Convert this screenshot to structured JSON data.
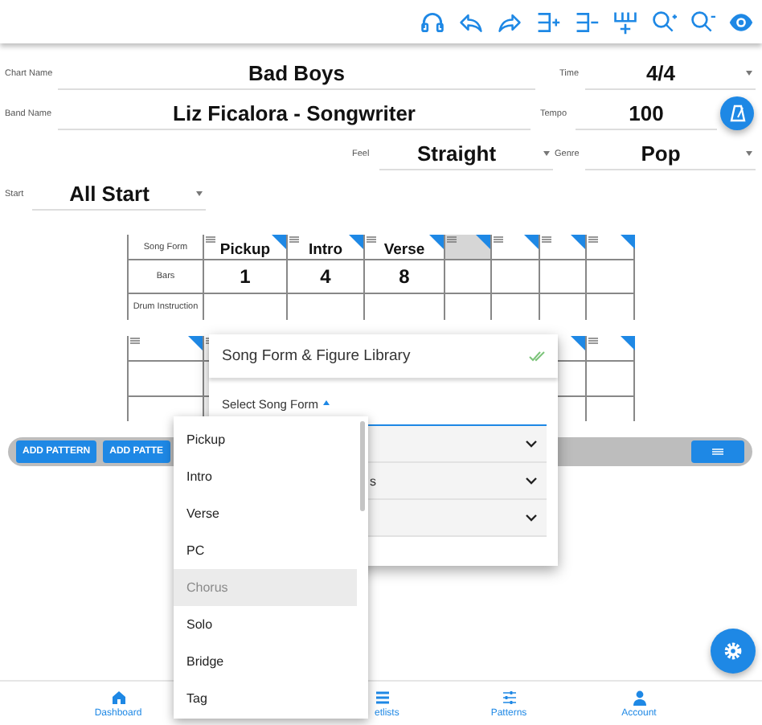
{
  "header_rows": [
    [
      {
        "label": "Chart Name",
        "value": "Bad Boys",
        "kind": "text"
      },
      {
        "label": "Time",
        "value": "4/4",
        "kind": "select"
      }
    ],
    [
      {
        "label": "Band Name",
        "value": "Liz Ficalora - Songwriter",
        "kind": "text"
      },
      {
        "label": "Tempo",
        "value": "100",
        "kind": "text"
      }
    ],
    [
      {
        "label": "Feel",
        "value": "Straight",
        "kind": "select"
      },
      {
        "label": "Genre",
        "value": "Pop",
        "kind": "select"
      }
    ],
    [
      {
        "label": "Start",
        "value": "All Start",
        "kind": "select"
      }
    ]
  ],
  "song_form_table": {
    "row_labels": [
      "Song Form",
      "Bars",
      "Drum Instruction"
    ],
    "columns": [
      {
        "section": "Pickup",
        "bars": "1",
        "selected": false
      },
      {
        "section": "Intro",
        "bars": "4",
        "selected": false
      },
      {
        "section": "Verse",
        "bars": "8",
        "selected": false
      },
      {
        "selected": true
      },
      {
        "selected": false
      },
      {
        "selected": false
      },
      {
        "selected": false
      }
    ]
  },
  "pattern_bar": {
    "buttons": [
      "ADD PATTERN",
      "ADD PATTE"
    ]
  },
  "library_popup": {
    "title": "Song Form & Figure Library",
    "select_label": "Select Song Form",
    "expanded": true,
    "sections": [
      {
        "expanded": false
      },
      {
        "label": "s",
        "expanded": false
      },
      {
        "expanded": false
      }
    ]
  },
  "song_form_dropdown": [
    {
      "label": "Pickup",
      "selected": false,
      "disabled": false
    },
    {
      "label": "Intro",
      "selected": false,
      "disabled": false
    },
    {
      "label": "Verse",
      "selected": false,
      "disabled": false
    },
    {
      "label": "PC",
      "selected": false,
      "disabled": false
    },
    {
      "label": "Chorus",
      "selected": true,
      "disabled": true
    },
    {
      "label": "Solo",
      "selected": false,
      "disabled": false
    },
    {
      "label": "Bridge",
      "selected": false,
      "disabled": false
    },
    {
      "label": "Tag",
      "selected": false,
      "disabled": false
    }
  ],
  "bottom_nav": [
    {
      "label": "Dashboard",
      "kind": "home"
    },
    {
      "label": "etlists",
      "kind": "list"
    },
    {
      "label": "Patterns",
      "kind": "sliders"
    },
    {
      "label": "Account",
      "kind": "person"
    }
  ]
}
